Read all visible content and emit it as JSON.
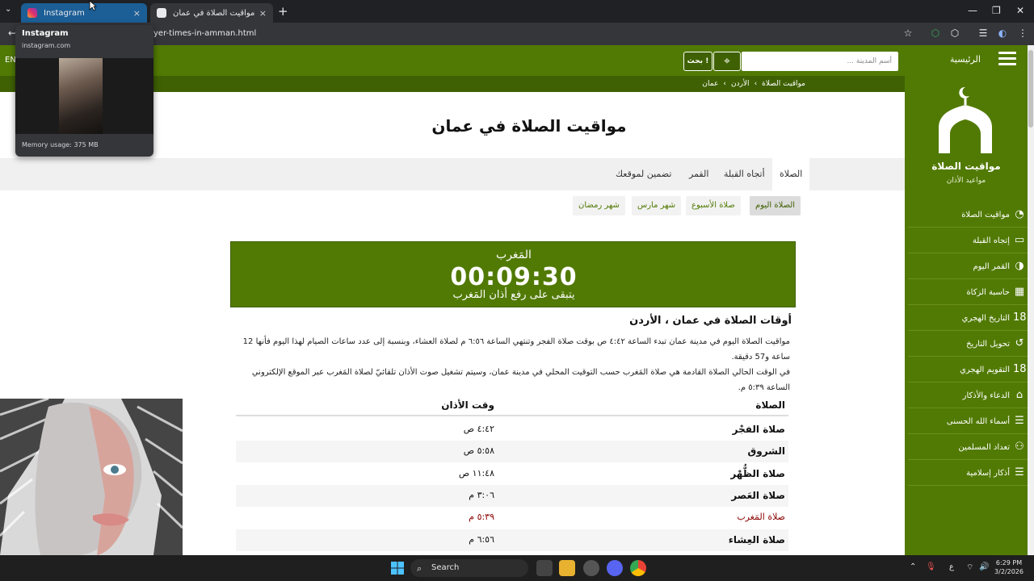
{
  "browser": {
    "tabs": [
      {
        "title": "Instagram",
        "active": false
      },
      {
        "title": "مواقيت الصلاة في عمان",
        "active": true
      }
    ],
    "url": "yer-times-in-amman.html",
    "new_tab": "+",
    "close": "×",
    "tab_search": "⌄",
    "window_controls": {
      "min": "—",
      "max": "❐",
      "close": "✕"
    },
    "toolbar_icons": {
      "back": "←",
      "bookmark": "☆",
      "extensions": "⬡",
      "menu": "⋮",
      "reading": "☰",
      "avatar": "◐"
    }
  },
  "tab_hover": {
    "title": "Instagram",
    "url": "instagram.com",
    "memory": "Memory usage: 375 MB"
  },
  "header": {
    "lang": "EN",
    "home": "الرئيسية",
    "search_placeholder": "أسم المدينة ...",
    "search_button": "بحث !",
    "location_icon": "⌖",
    "breadcrumb": [
      "مواقيت الصلاة",
      "الأردن",
      "عمان"
    ],
    "breadcrumb_sep": "›"
  },
  "sidebar": {
    "site_name": "مواقيت الصلاة",
    "site_sub": "مواعيد الأذان",
    "items": [
      {
        "label": "مواقيت الصلاة",
        "icon": "◔"
      },
      {
        "label": "إتجاه القبلة",
        "icon": "▭"
      },
      {
        "label": "القمر اليوم",
        "icon": "◑"
      },
      {
        "label": "حاسبة الزكاة",
        "icon": "▦"
      },
      {
        "label": "التاريخ الهجري",
        "icon": "18"
      },
      {
        "label": "تحويل التاريخ",
        "icon": "↺"
      },
      {
        "label": "التقويم الهجري",
        "icon": "18"
      },
      {
        "label": "الدعاء والأذكار",
        "icon": "⌂"
      },
      {
        "label": "أسماء الله الحسنى",
        "icon": "☰"
      },
      {
        "label": "تعداد المسلمين",
        "icon": "⚇"
      },
      {
        "label": "أذكار إسلامية",
        "icon": "☰"
      }
    ]
  },
  "main": {
    "title": "مواقيت الصلاة في عمان",
    "tabs": [
      "الصلاة",
      "أتجاه القبلة",
      "القمر",
      "تضمين لموقعك"
    ],
    "pills": [
      "الصلاة اليوم",
      "صلاة الأسبوع",
      "شهر مارس",
      "شهر رمضان"
    ],
    "countdown": {
      "prayer": "المَغرب",
      "time": "00:09:30",
      "subtitle": "يتبقى على رفع أذان المَغرب"
    },
    "section_heading": "أوقات الصلاة في عمان ، الأردن",
    "para1": "مواقيت الصلاة اليوم في مدينة عمان تبدء الساعة ٤:٤٢ ص بوقت صلاة الفجر وتنتهي الساعة ٦:٥٦ م لصلاة العشاء، وبنسبة إلى عدد ساعات الصيام لهذا اليوم فأنها 12 ساعة و57 دقيقة.",
    "para2": "في الوقت الحالي الصلاة القادمة هي صلاة المَغرب حسب التوقيت المحلي في مدينة عمان، وسيتم تشغيل صوت الأذان تلقائيّ لصلاة المَغرب عبر الموقع الإلكتروني الساعة ٥:٣٩ م.",
    "table": {
      "headers": {
        "prayer": "الصلاة",
        "time": "وقت الأذان"
      },
      "rows": [
        {
          "name": "صلاة الفجْر",
          "time": "٤:٤٢ ص"
        },
        {
          "name": "الشروق",
          "time": "٥:٥٨ ص"
        },
        {
          "name": "صلاة الظُّهْر",
          "time": "١١:٤٨ ص"
        },
        {
          "name": "صلاة العَصر",
          "time": "٣:٠٦ م"
        },
        {
          "name": "صلاة المَغرب",
          "time": "٥:٣٩ م",
          "highlight": true
        },
        {
          "name": "صلاة العِشاء",
          "time": "٦:٥٦ م"
        }
      ]
    }
  },
  "taskbar": {
    "search": "Search",
    "time": "6:29 PM",
    "date": "3/2/2026",
    "lang": "ع",
    "tray_up": "⌃",
    "mic": "🎙",
    "wifi": "⌔",
    "volume": "🔊"
  },
  "colors": {
    "brand": "#517a04",
    "brand_dark": "#3f6103",
    "highlight": "#8b0000"
  }
}
